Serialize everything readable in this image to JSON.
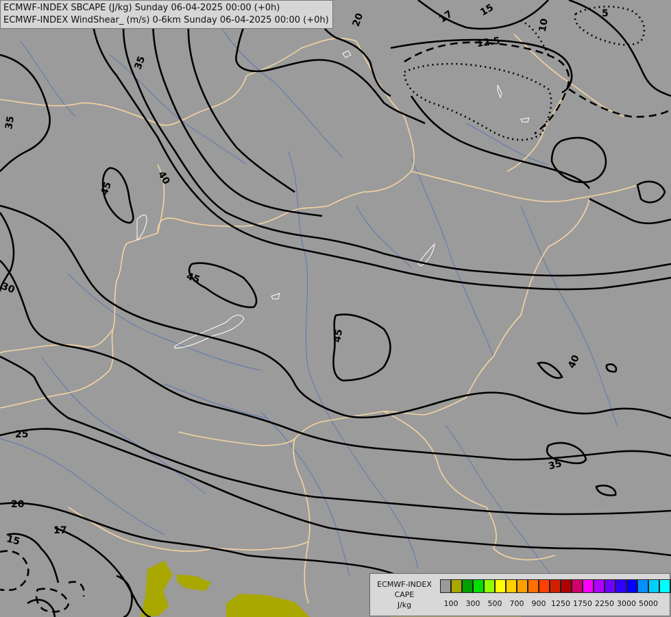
{
  "header": {
    "line1": "ECMWF-INDEX SBCAPE (J/kg) Sunday 06-04-2025 00:00 (+0h)",
    "line2": "ECMWF-INDEX WindShear_ (m/s) 0-6km Sunday 06-04-2025 00:00 (+0h)"
  },
  "legend": {
    "title_lines": [
      "ECMWF-INDEX",
      "CAPE",
      "J/kg"
    ],
    "swatch_colors": [
      "#9b9b9b",
      "#a8a800",
      "#00a000",
      "#00e000",
      "#90ff00",
      "#ffff00",
      "#ffd000",
      "#ffa000",
      "#ff7000",
      "#ff4000",
      "#d02000",
      "#b00000",
      "#d0006a",
      "#ff00ff",
      "#b000ff",
      "#7000ff",
      "#3000ff",
      "#0000ff",
      "#0090ff",
      "#00d0ff",
      "#00ffff",
      "#80ffff",
      "#ffffff"
    ],
    "ticks": [
      "100",
      "300",
      "500",
      "700",
      "900",
      "1250",
      "1750",
      "2250",
      "3000",
      "5000"
    ]
  },
  "contour_labels": [
    "20",
    "17",
    "15",
    "5",
    "10",
    "12.5",
    "35",
    "35",
    "40",
    "45",
    "45",
    "45",
    "30",
    "40",
    "35",
    "25",
    "20",
    "17",
    "15"
  ],
  "colors": {
    "background": "#9b9b9b",
    "cape_low": "#a8a800",
    "border": "#f4d4a0",
    "river": "#5a78b0",
    "contour": "#000000",
    "lake": "#ffffff"
  }
}
